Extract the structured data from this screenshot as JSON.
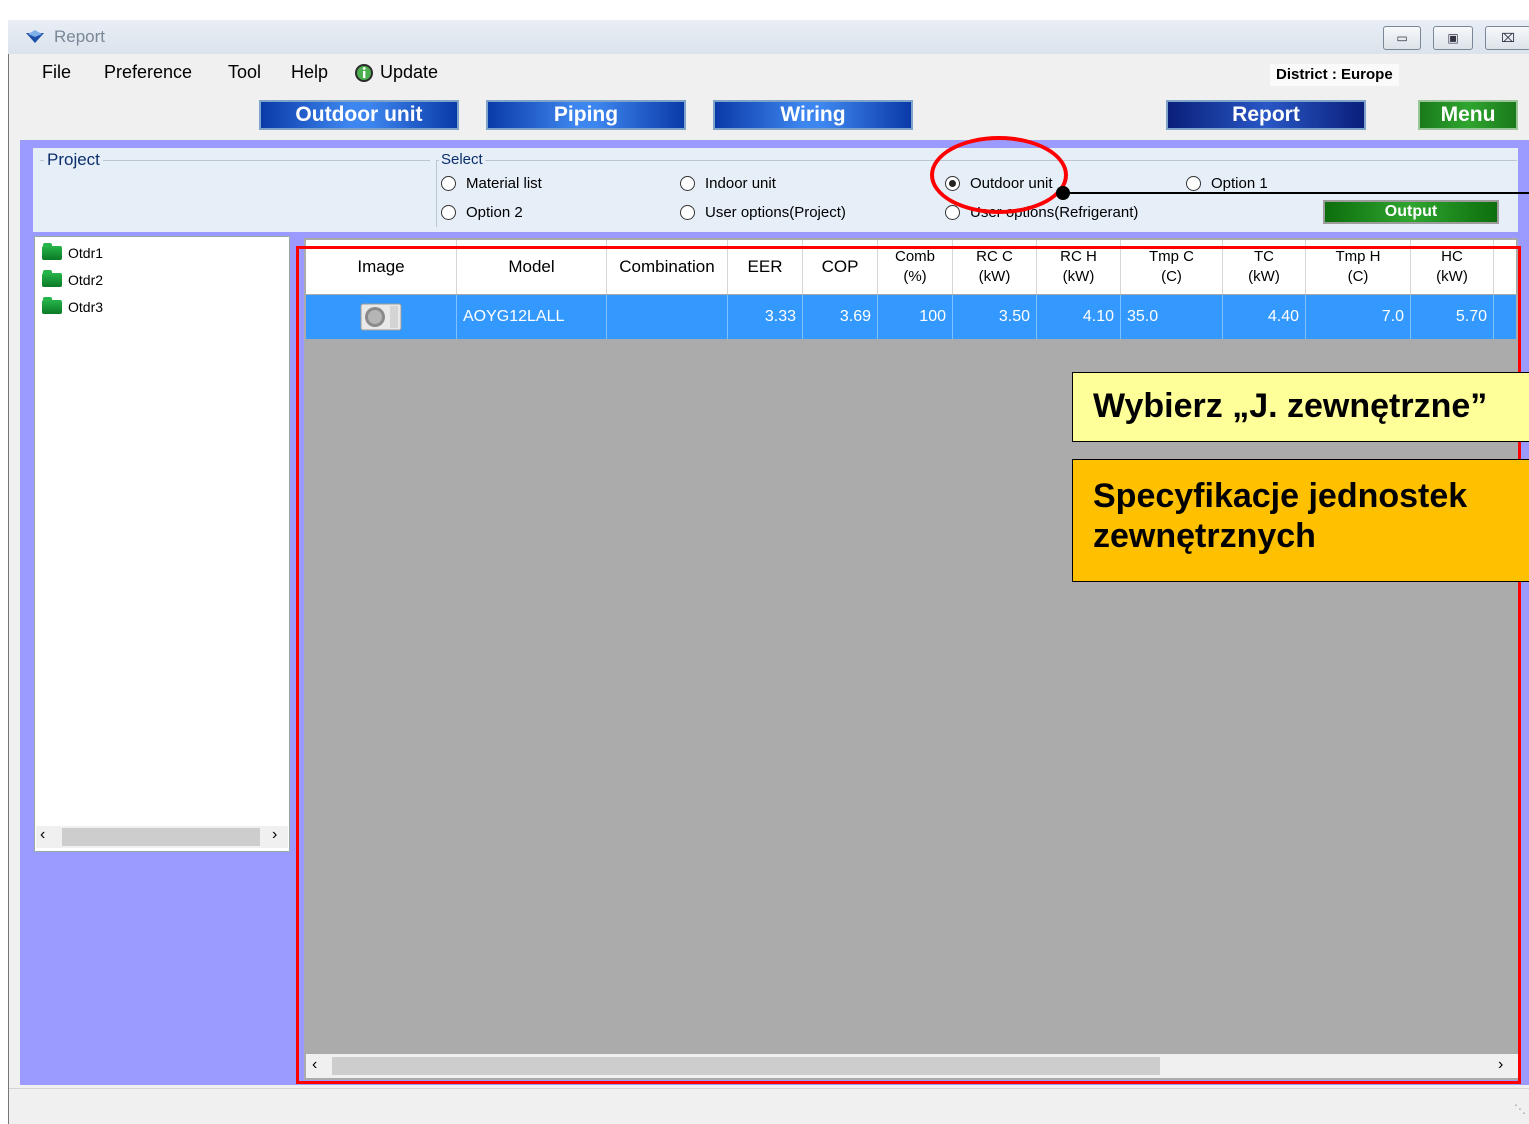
{
  "window": {
    "title": "Report",
    "controls": [
      "minimize",
      "restore",
      "close"
    ]
  },
  "menu": {
    "items": [
      "File",
      "Preference",
      "Tool",
      "Help"
    ],
    "update_label": "Update",
    "district": "District : Europe"
  },
  "toolbar": {
    "outdoor_unit": "Outdoor unit",
    "piping": "Piping",
    "wiring": "Wiring",
    "report": "Report",
    "menu": "Menu"
  },
  "project": {
    "label": "Project",
    "tree": [
      "Otdr1",
      "Otdr2",
      "Otdr3"
    ]
  },
  "select": {
    "label": "Select",
    "options": [
      "Material list",
      "Indoor unit",
      "Outdoor unit",
      "Option 1",
      "Option 2",
      "User options(Project)",
      "User options(Refrigerant)"
    ],
    "selected": "Outdoor unit",
    "output_label": "Output"
  },
  "grid": {
    "columns": [
      {
        "top": "Image"
      },
      {
        "top": "Model"
      },
      {
        "top": "Combination"
      },
      {
        "top": "EER"
      },
      {
        "top": "COP"
      },
      {
        "top": "Comb",
        "bottom": "(%)"
      },
      {
        "top": "RC C",
        "bottom": "(kW)"
      },
      {
        "top": "RC H",
        "bottom": "(kW)"
      },
      {
        "top": "Tmp C",
        "bottom": "(C)"
      },
      {
        "top": "TC",
        "bottom": "(kW)"
      },
      {
        "top": "Tmp H",
        "bottom": "(C)"
      },
      {
        "top": "HC",
        "bottom": "(kW)"
      }
    ],
    "rows": [
      {
        "model": "AOYG12LALL",
        "combination": "",
        "eer": "3.33",
        "cop": "3.69",
        "comb": "100",
        "rc_c": "3.50",
        "rc_h": "4.10",
        "tmp_c": "35.0",
        "tc": "4.40",
        "tmp_h": "7.0",
        "hc": "5.70"
      }
    ]
  },
  "annotations": {
    "callout_1": "Wybierz „J. zewnętrzne”",
    "callout_2_line1": "Specyfikacje jednostek",
    "callout_2_line2": "zewnętrznych"
  },
  "colors": {
    "row_selected": "#3399ff",
    "annotation_red": "#ff0000",
    "callout_yellow": "#ffff99",
    "callout_orange": "#ffc000",
    "panel_purple": "#9a9aff"
  }
}
